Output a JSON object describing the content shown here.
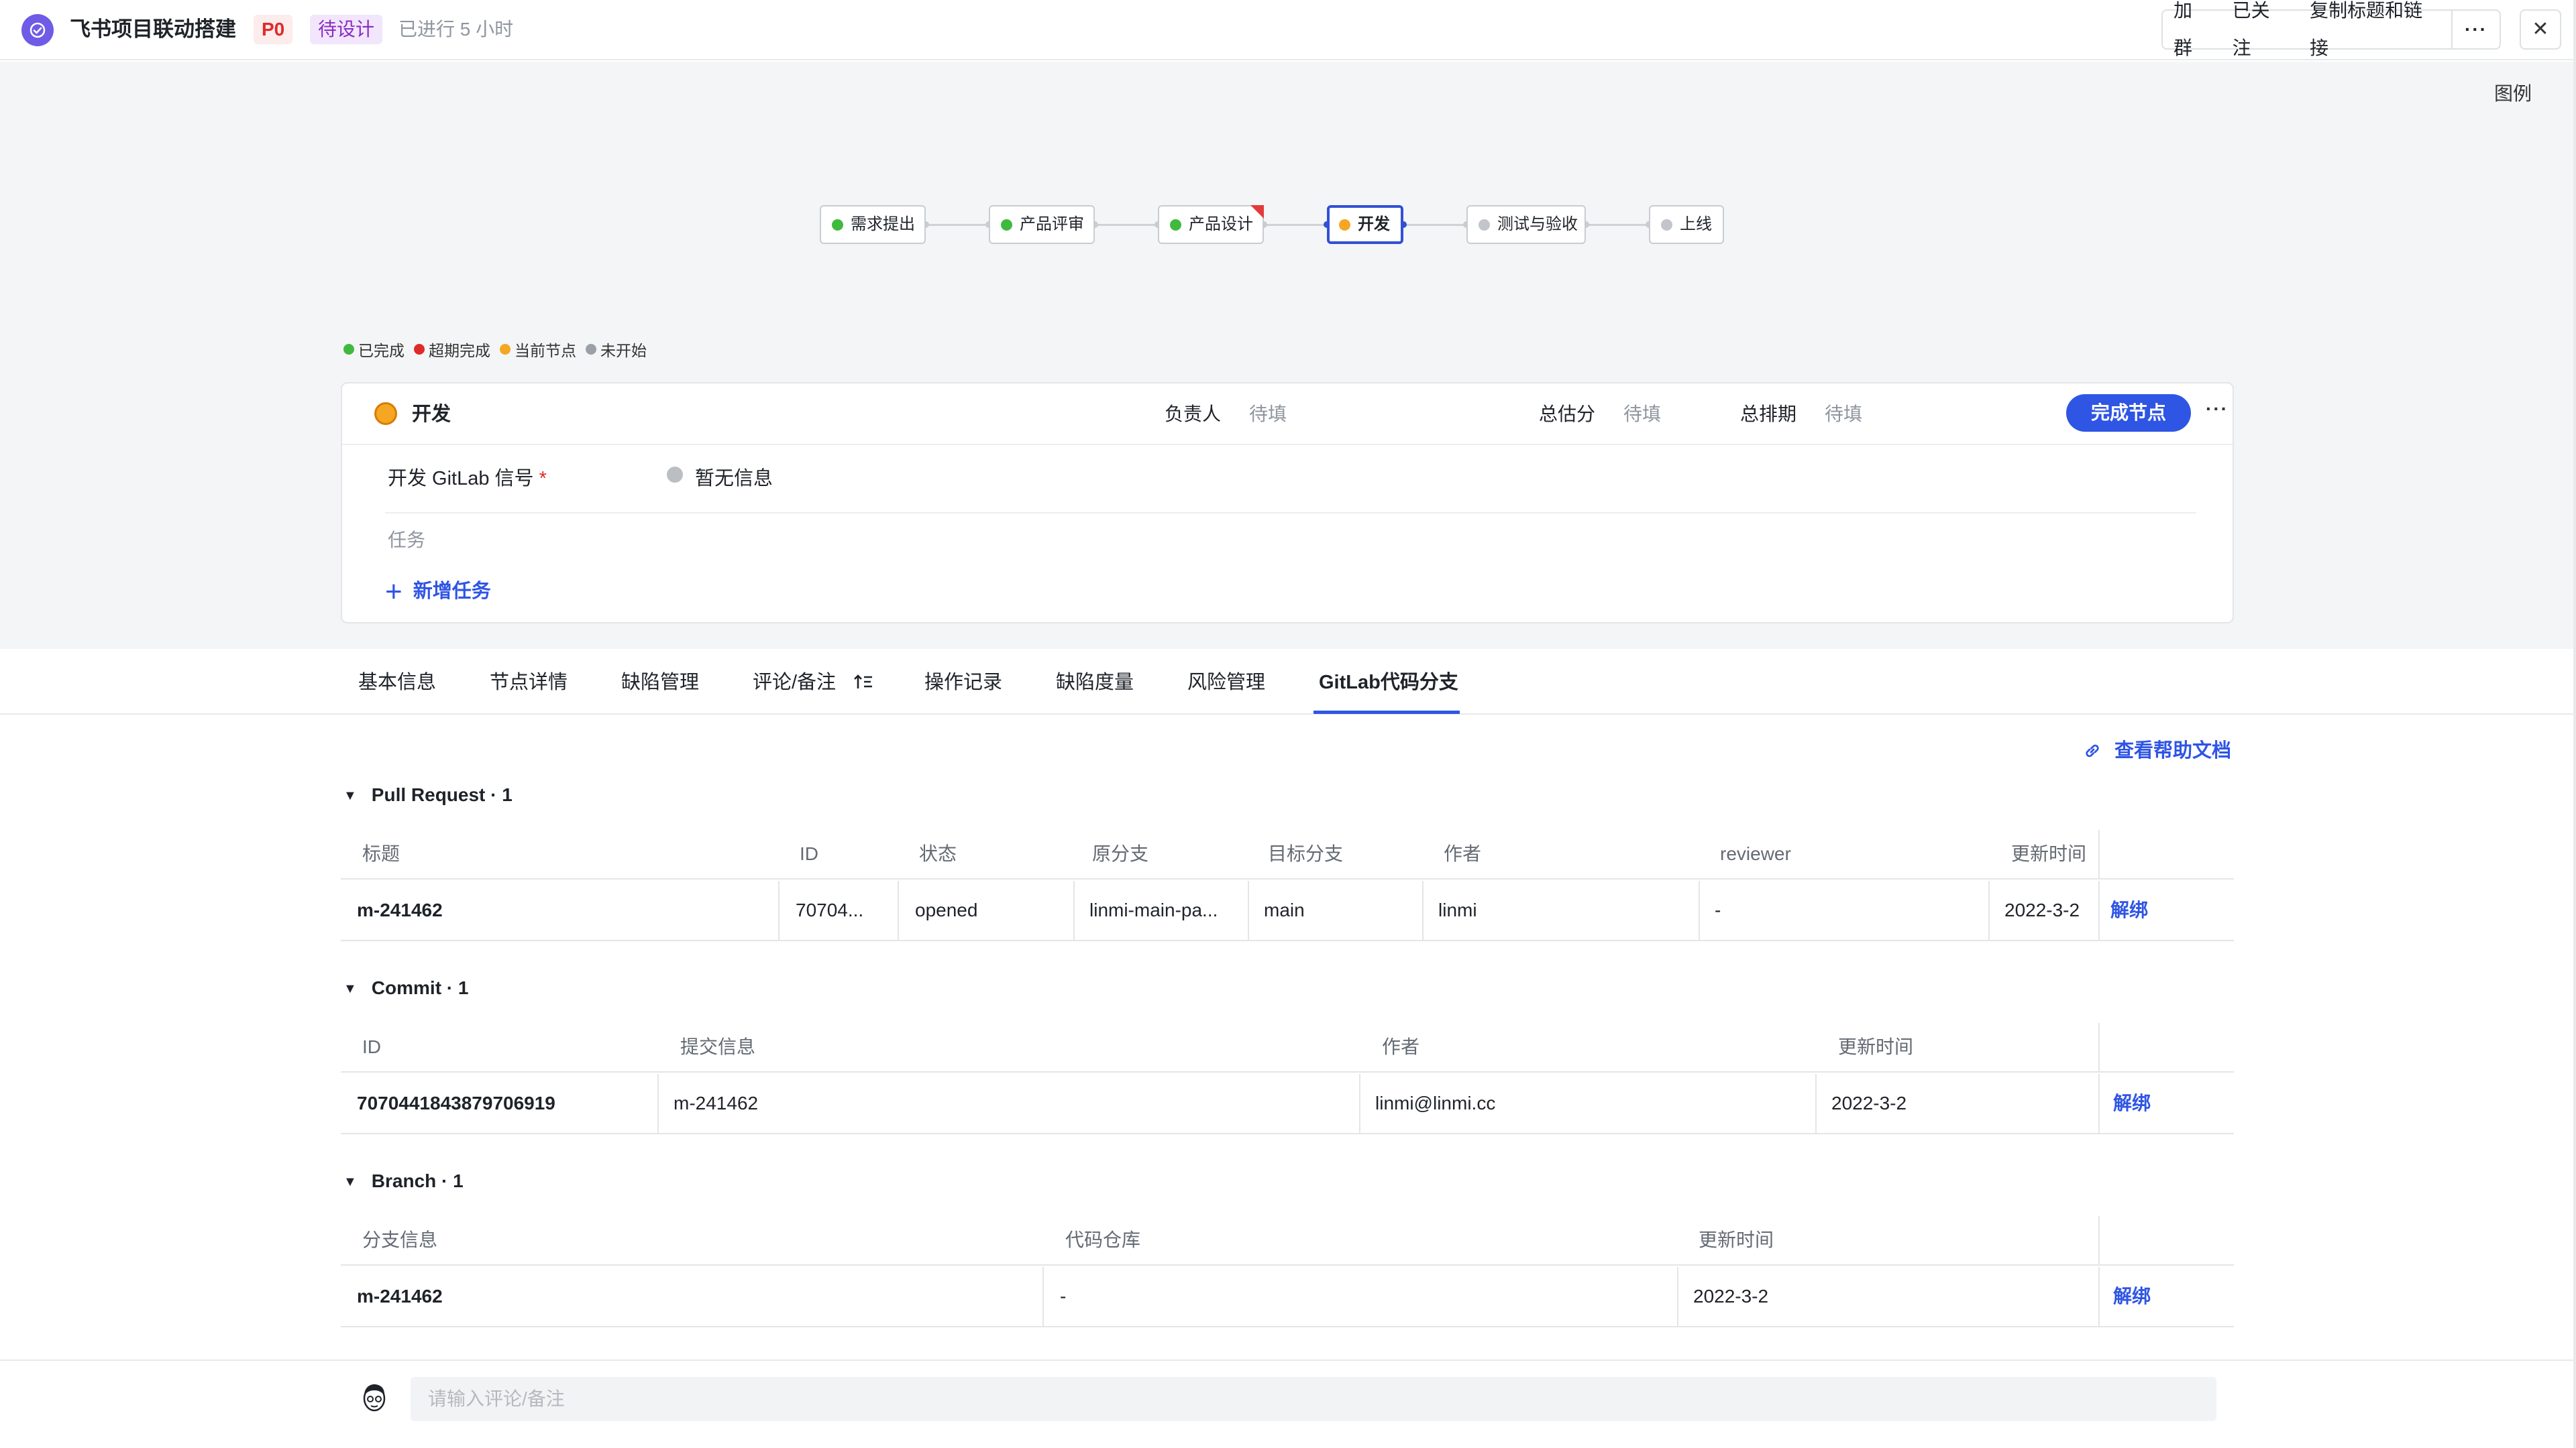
{
  "header": {
    "title": "飞书项目联动搭建",
    "priority": "P0",
    "status": "待设计",
    "elapsed": "已进行 5 小时",
    "buttons": {
      "join_group": "加群",
      "following": "已关注",
      "copy_link": "复制标题和链接",
      "more": "···",
      "close": "✕"
    }
  },
  "workflow": {
    "legend_link": "图例",
    "nodes": [
      {
        "label": "需求提出",
        "state": "completed"
      },
      {
        "label": "产品评审",
        "state": "completed"
      },
      {
        "label": "产品设计",
        "state": "completed",
        "flag": "overdue"
      },
      {
        "label": "开发",
        "state": "current"
      },
      {
        "label": "测试与验收",
        "state": "not-started"
      },
      {
        "label": "上线",
        "state": "not-started"
      }
    ],
    "status_legend": [
      {
        "label": "已完成",
        "color": "#3fba3f"
      },
      {
        "label": "超期完成",
        "color": "#e02a2a"
      },
      {
        "label": "当前节点",
        "color": "#f5a623"
      },
      {
        "label": "未开始",
        "color": "#9aa0a6"
      }
    ]
  },
  "node_card": {
    "title": "开发",
    "owner_label": "负责人",
    "owner_value": "待填",
    "estimate_label": "总估分",
    "estimate_value": "待填",
    "schedule_label": "总排期",
    "schedule_value": "待填",
    "complete_button": "完成节点",
    "more": "···",
    "gitlab_field_label": "开发 GitLab 信号",
    "required_mark": "*",
    "gitlab_field_value": "暂无信息",
    "tasks_label": "任务",
    "add_task": "新增任务"
  },
  "tabs": [
    {
      "label": "基本信息",
      "active": false
    },
    {
      "label": "节点详情",
      "active": false
    },
    {
      "label": "缺陷管理",
      "active": false
    },
    {
      "label": "评论/备注",
      "active": false
    },
    {
      "label": "操作记录",
      "active": false
    },
    {
      "label": "缺陷度量",
      "active": false
    },
    {
      "label": "风险管理",
      "active": false
    },
    {
      "label": "GitLab代码分支",
      "active": true
    }
  ],
  "help_link": "查看帮助文档",
  "pull_requests": {
    "title": "Pull Request · 1",
    "columns": [
      "标题",
      "ID",
      "状态",
      "原分支",
      "目标分支",
      "作者",
      "reviewer",
      "更新时间"
    ],
    "rows": [
      {
        "title": "m-241462",
        "id": "70704...",
        "status": "opened",
        "source": "linmi-main-pa...",
        "target": "main",
        "author": "linmi",
        "reviewer": "-",
        "updated": "2022-3-2",
        "action": "解绑"
      }
    ]
  },
  "commits": {
    "title": "Commit · 1",
    "columns": [
      "ID",
      "提交信息",
      "作者",
      "更新时间"
    ],
    "rows": [
      {
        "id": "7070441843879706919",
        "message": "m-241462",
        "author": "linmi@linmi.cc",
        "updated": "2022-3-2",
        "action": "解绑"
      }
    ]
  },
  "branches": {
    "title": "Branch · 1",
    "columns": [
      "分支信息",
      "代码仓库",
      "更新时间"
    ],
    "rows": [
      {
        "branch": "m-241462",
        "repo": "-",
        "updated": "2022-3-2",
        "action": "解绑"
      }
    ]
  },
  "comment": {
    "placeholder": "请输入评论/备注"
  }
}
